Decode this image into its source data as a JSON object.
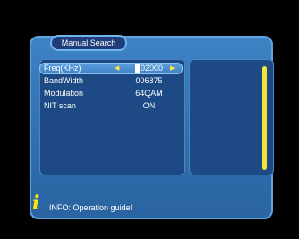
{
  "menu": {
    "title": "Manual Search"
  },
  "rows": [
    {
      "label": "Freq(KHz)",
      "value": "02000",
      "selected": true
    },
    {
      "label": "BandWidth",
      "value": "006875"
    },
    {
      "label": "Modulation",
      "value": "64QAM"
    },
    {
      "label": "NIT scan",
      "value": "ON"
    }
  ],
  "arrows": {
    "left": "◀",
    "right": "▶"
  },
  "info": {
    "icon": "i",
    "text": "INFO: Operation guide!"
  },
  "colors": {
    "panel": "#2f6eae",
    "list_bg": "#1d4a84",
    "highlight": "#4a8fd2",
    "scrollbar": "#f0e73a",
    "info_icon": "#ffe600"
  }
}
